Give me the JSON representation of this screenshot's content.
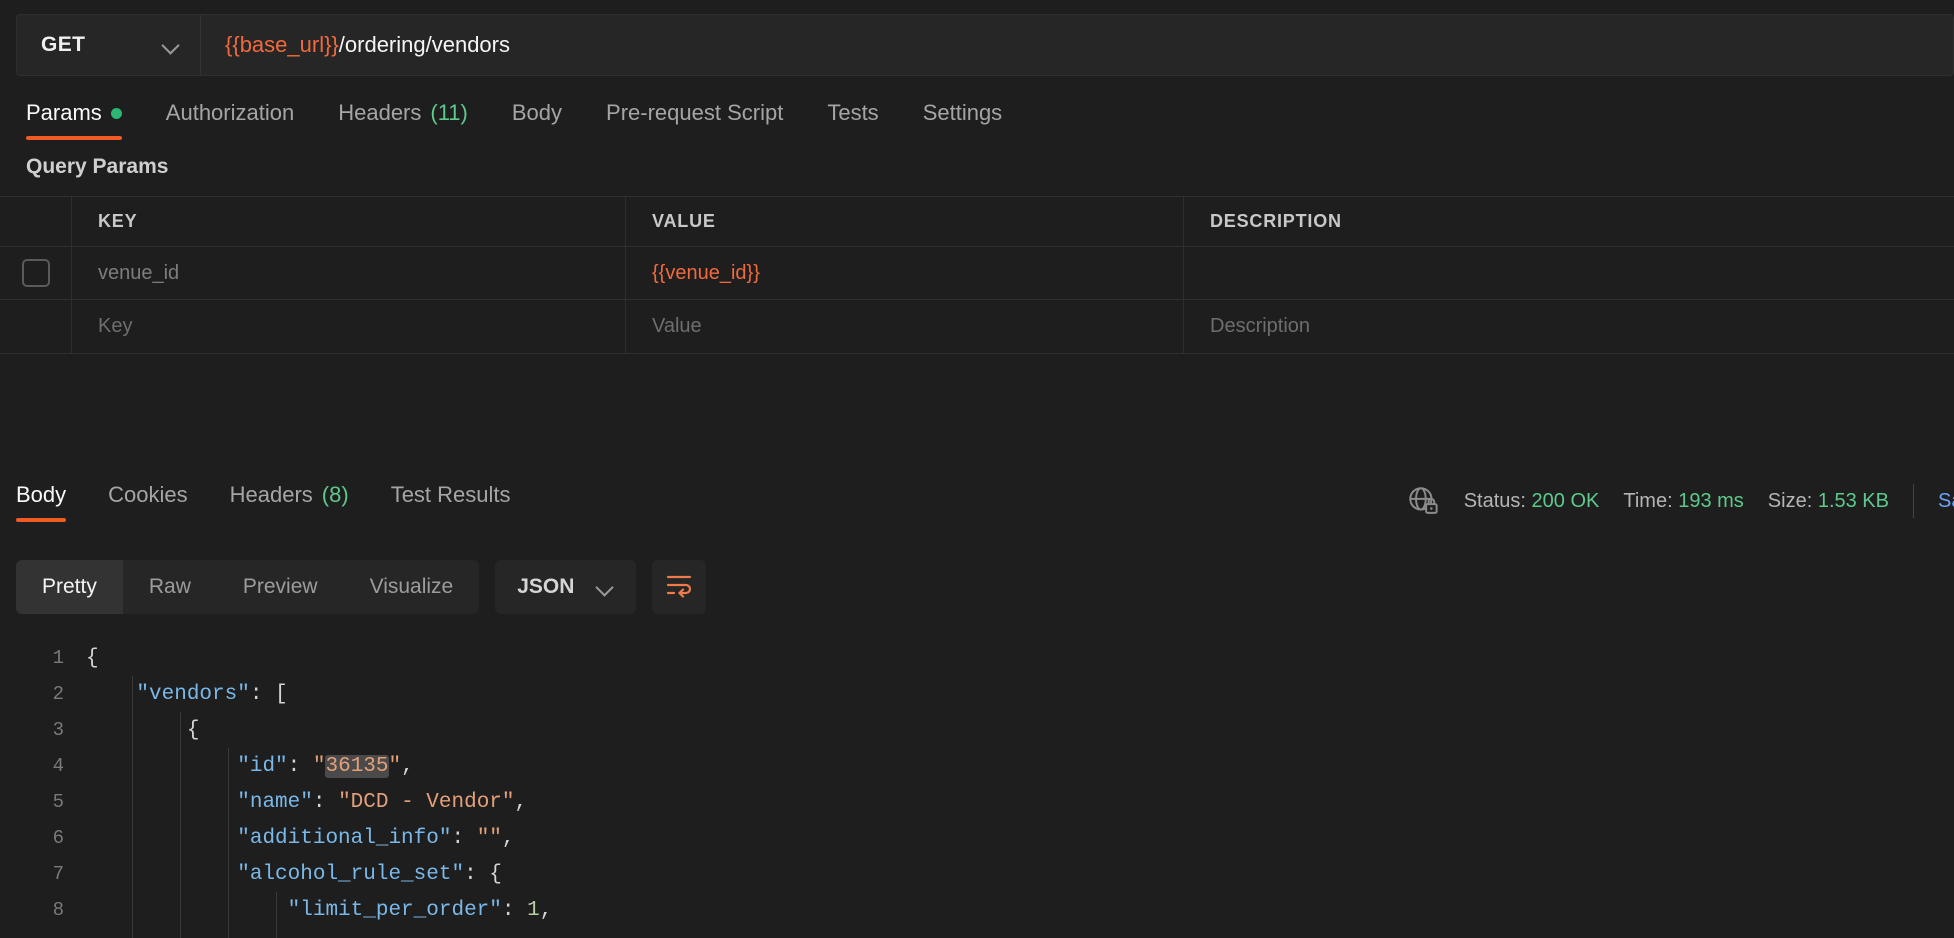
{
  "request": {
    "method": "GET",
    "method_icon": "chevron-down-icon",
    "url_variable": "{{base_url}}",
    "url_path": "/ordering/vendors"
  },
  "request_tabs": [
    {
      "label": "Params",
      "badge": "",
      "dot": true,
      "active": true
    },
    {
      "label": "Authorization",
      "badge": "",
      "dot": false,
      "active": false
    },
    {
      "label": "Headers",
      "badge": "(11)",
      "dot": false,
      "active": false
    },
    {
      "label": "Body",
      "badge": "",
      "dot": false,
      "active": false
    },
    {
      "label": "Pre-request Script",
      "badge": "",
      "dot": false,
      "active": false
    },
    {
      "label": "Tests",
      "badge": "",
      "dot": false,
      "active": false
    },
    {
      "label": "Settings",
      "badge": "",
      "dot": false,
      "active": false
    }
  ],
  "query_params": {
    "section_title": "Query Params",
    "columns": [
      "KEY",
      "VALUE",
      "DESCRIPTION"
    ],
    "rows": [
      {
        "checked": false,
        "key": "venue_id",
        "value": "{{venue_id}}",
        "description": ""
      },
      {
        "checked": false,
        "key": "Key",
        "value": "Value",
        "description": "Description"
      }
    ]
  },
  "response_tabs": [
    {
      "label": "Body",
      "badge": "",
      "active": true
    },
    {
      "label": "Cookies",
      "badge": "",
      "active": false
    },
    {
      "label": "Headers",
      "badge": "(8)",
      "active": false
    },
    {
      "label": "Test Results",
      "badge": "",
      "active": false
    }
  ],
  "response_meta": {
    "network_icon": "globe-lock-icon",
    "status_label": "Status:",
    "status_value": "200 OK",
    "time_label": "Time:",
    "time_value": "193 ms",
    "size_label": "Size:",
    "size_value": "1.53 KB",
    "save_label": "Save Response",
    "status_color": "#5ec98c"
  },
  "body_toolbar": {
    "view_modes": [
      "Pretty",
      "Raw",
      "Preview",
      "Visualize"
    ],
    "active_view": "Pretty",
    "format": "JSON",
    "format_caret_icon": "chevron-down-icon",
    "wrap_icon": "wrap-lines-icon"
  },
  "code": {
    "language": "json",
    "highlight_token": "36135",
    "lines": [
      {
        "n": "1",
        "indent": 0,
        "tokens": [
          {
            "t": "{",
            "c": "pun"
          }
        ]
      },
      {
        "n": "2",
        "indent": 1,
        "tokens": [
          {
            "t": "\"vendors\"",
            "c": "key"
          },
          {
            "t": ": [",
            "c": "pun"
          }
        ]
      },
      {
        "n": "3",
        "indent": 2,
        "tokens": [
          {
            "t": "{",
            "c": "pun"
          }
        ]
      },
      {
        "n": "4",
        "indent": 3,
        "tokens": [
          {
            "t": "\"id\"",
            "c": "key"
          },
          {
            "t": ": ",
            "c": "pun"
          },
          {
            "t": "\"",
            "c": "str"
          },
          {
            "t": "36135",
            "c": "str-hl"
          },
          {
            "t": "\"",
            "c": "str"
          },
          {
            "t": ",",
            "c": "pun"
          }
        ]
      },
      {
        "n": "5",
        "indent": 3,
        "tokens": [
          {
            "t": "\"name\"",
            "c": "key"
          },
          {
            "t": ": ",
            "c": "pun"
          },
          {
            "t": "\"DCD - Vendor\"",
            "c": "str"
          },
          {
            "t": ",",
            "c": "pun"
          }
        ]
      },
      {
        "n": "6",
        "indent": 3,
        "tokens": [
          {
            "t": "\"additional_info\"",
            "c": "key"
          },
          {
            "t": ": ",
            "c": "pun"
          },
          {
            "t": "\"\"",
            "c": "str"
          },
          {
            "t": ",",
            "c": "pun"
          }
        ]
      },
      {
        "n": "7",
        "indent": 3,
        "tokens": [
          {
            "t": "\"alcohol_rule_set\"",
            "c": "key"
          },
          {
            "t": ": {",
            "c": "pun"
          }
        ]
      },
      {
        "n": "8",
        "indent": 4,
        "tokens": [
          {
            "t": "\"limit_per_order\"",
            "c": "key"
          },
          {
            "t": ": ",
            "c": "pun"
          },
          {
            "t": "1",
            "c": "num"
          },
          {
            "t": ",",
            "c": "pun"
          }
        ]
      }
    ]
  },
  "theme": {
    "accent": "#ef5b25",
    "variable": "#f2693c",
    "green": "#5ec98c",
    "bg": "#1e1e1e",
    "panel": "#262626"
  }
}
